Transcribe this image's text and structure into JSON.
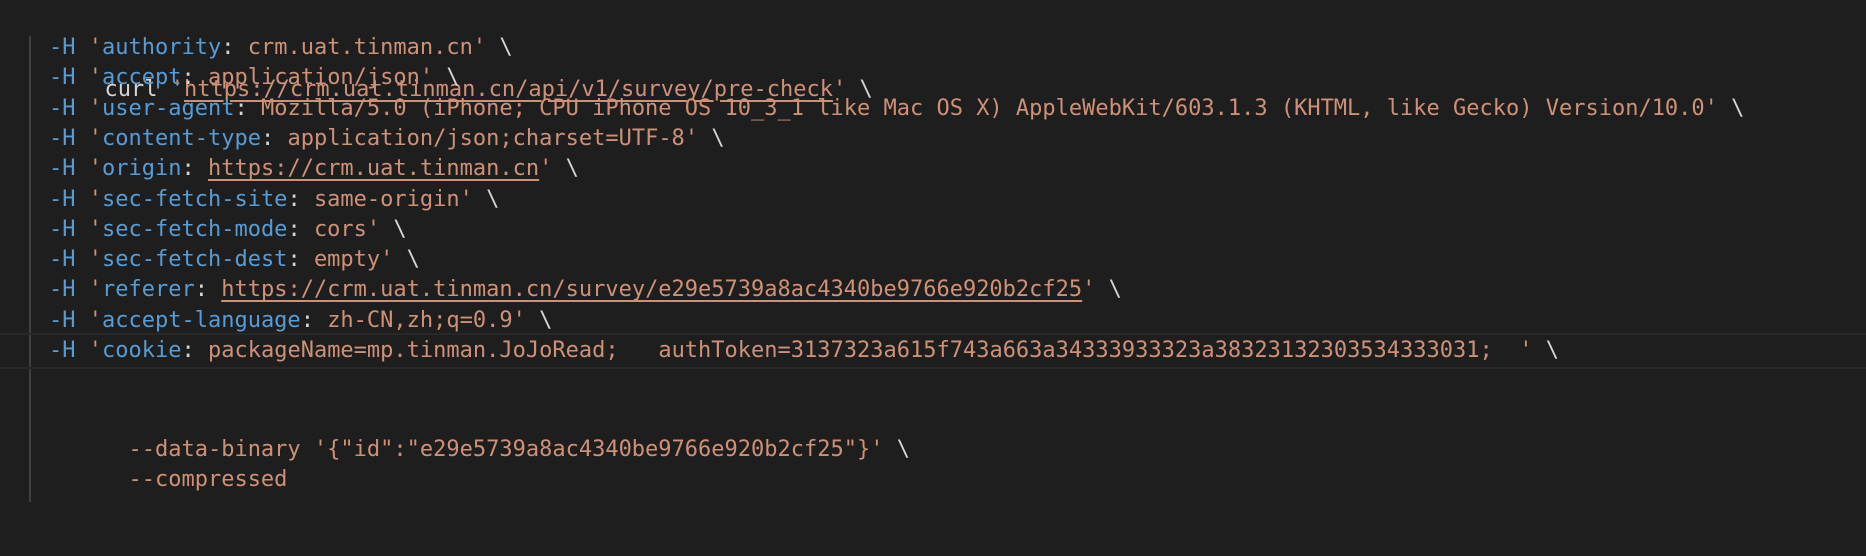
{
  "command": "curl",
  "url": "https://crm.uat.tinman.cn/api/v1/survey/pre-check",
  "continuation": "\\",
  "header_flag": "-H",
  "headers": [
    {
      "name": "authority",
      "value": "crm.uat.tinman.cn",
      "is_link": false
    },
    {
      "name": "accept",
      "value": "application/json",
      "is_link": false
    },
    {
      "name": "user-agent",
      "value": "Mozilla/5.0 (iPhone; CPU iPhone OS 10_3_1 like Mac OS X) AppleWebKit/603.1.3 (KHTML, like Gecko) Version/10.0",
      "is_link": false
    },
    {
      "name": "content-type",
      "value": "application/json;charset=UTF-8",
      "is_link": false
    },
    {
      "name": "origin",
      "value": "https://crm.uat.tinman.cn",
      "is_link": true
    },
    {
      "name": "sec-fetch-site",
      "value": "same-origin",
      "is_link": false
    },
    {
      "name": "sec-fetch-mode",
      "value": "cors",
      "is_link": false
    },
    {
      "name": "sec-fetch-dest",
      "value": "empty",
      "is_link": false
    },
    {
      "name": "referer",
      "value": "https://crm.uat.tinman.cn/survey/e29e5739a8ac4340be9766e920b2cf25",
      "is_link": true
    },
    {
      "name": "accept-language",
      "value": "zh-CN,zh;q=0.9",
      "is_link": false
    },
    {
      "name": "cookie",
      "value": "packageName=mp.tinman.JoJoRead;   authToken=3137323a615f743a663a34333933323a38323132303534333031;  ",
      "is_link": false
    }
  ],
  "data_binary_flag": "--data-binary",
  "data_binary_value": "{\"id\":\"e29e5739a8ac4340be9766e920b2cf25\"}",
  "compressed_flag": "--compressed",
  "colors": {
    "background": "#1e1e1e",
    "string": "#ce9178",
    "keyword": "#569cd6",
    "plain": "#d4d4d4"
  }
}
